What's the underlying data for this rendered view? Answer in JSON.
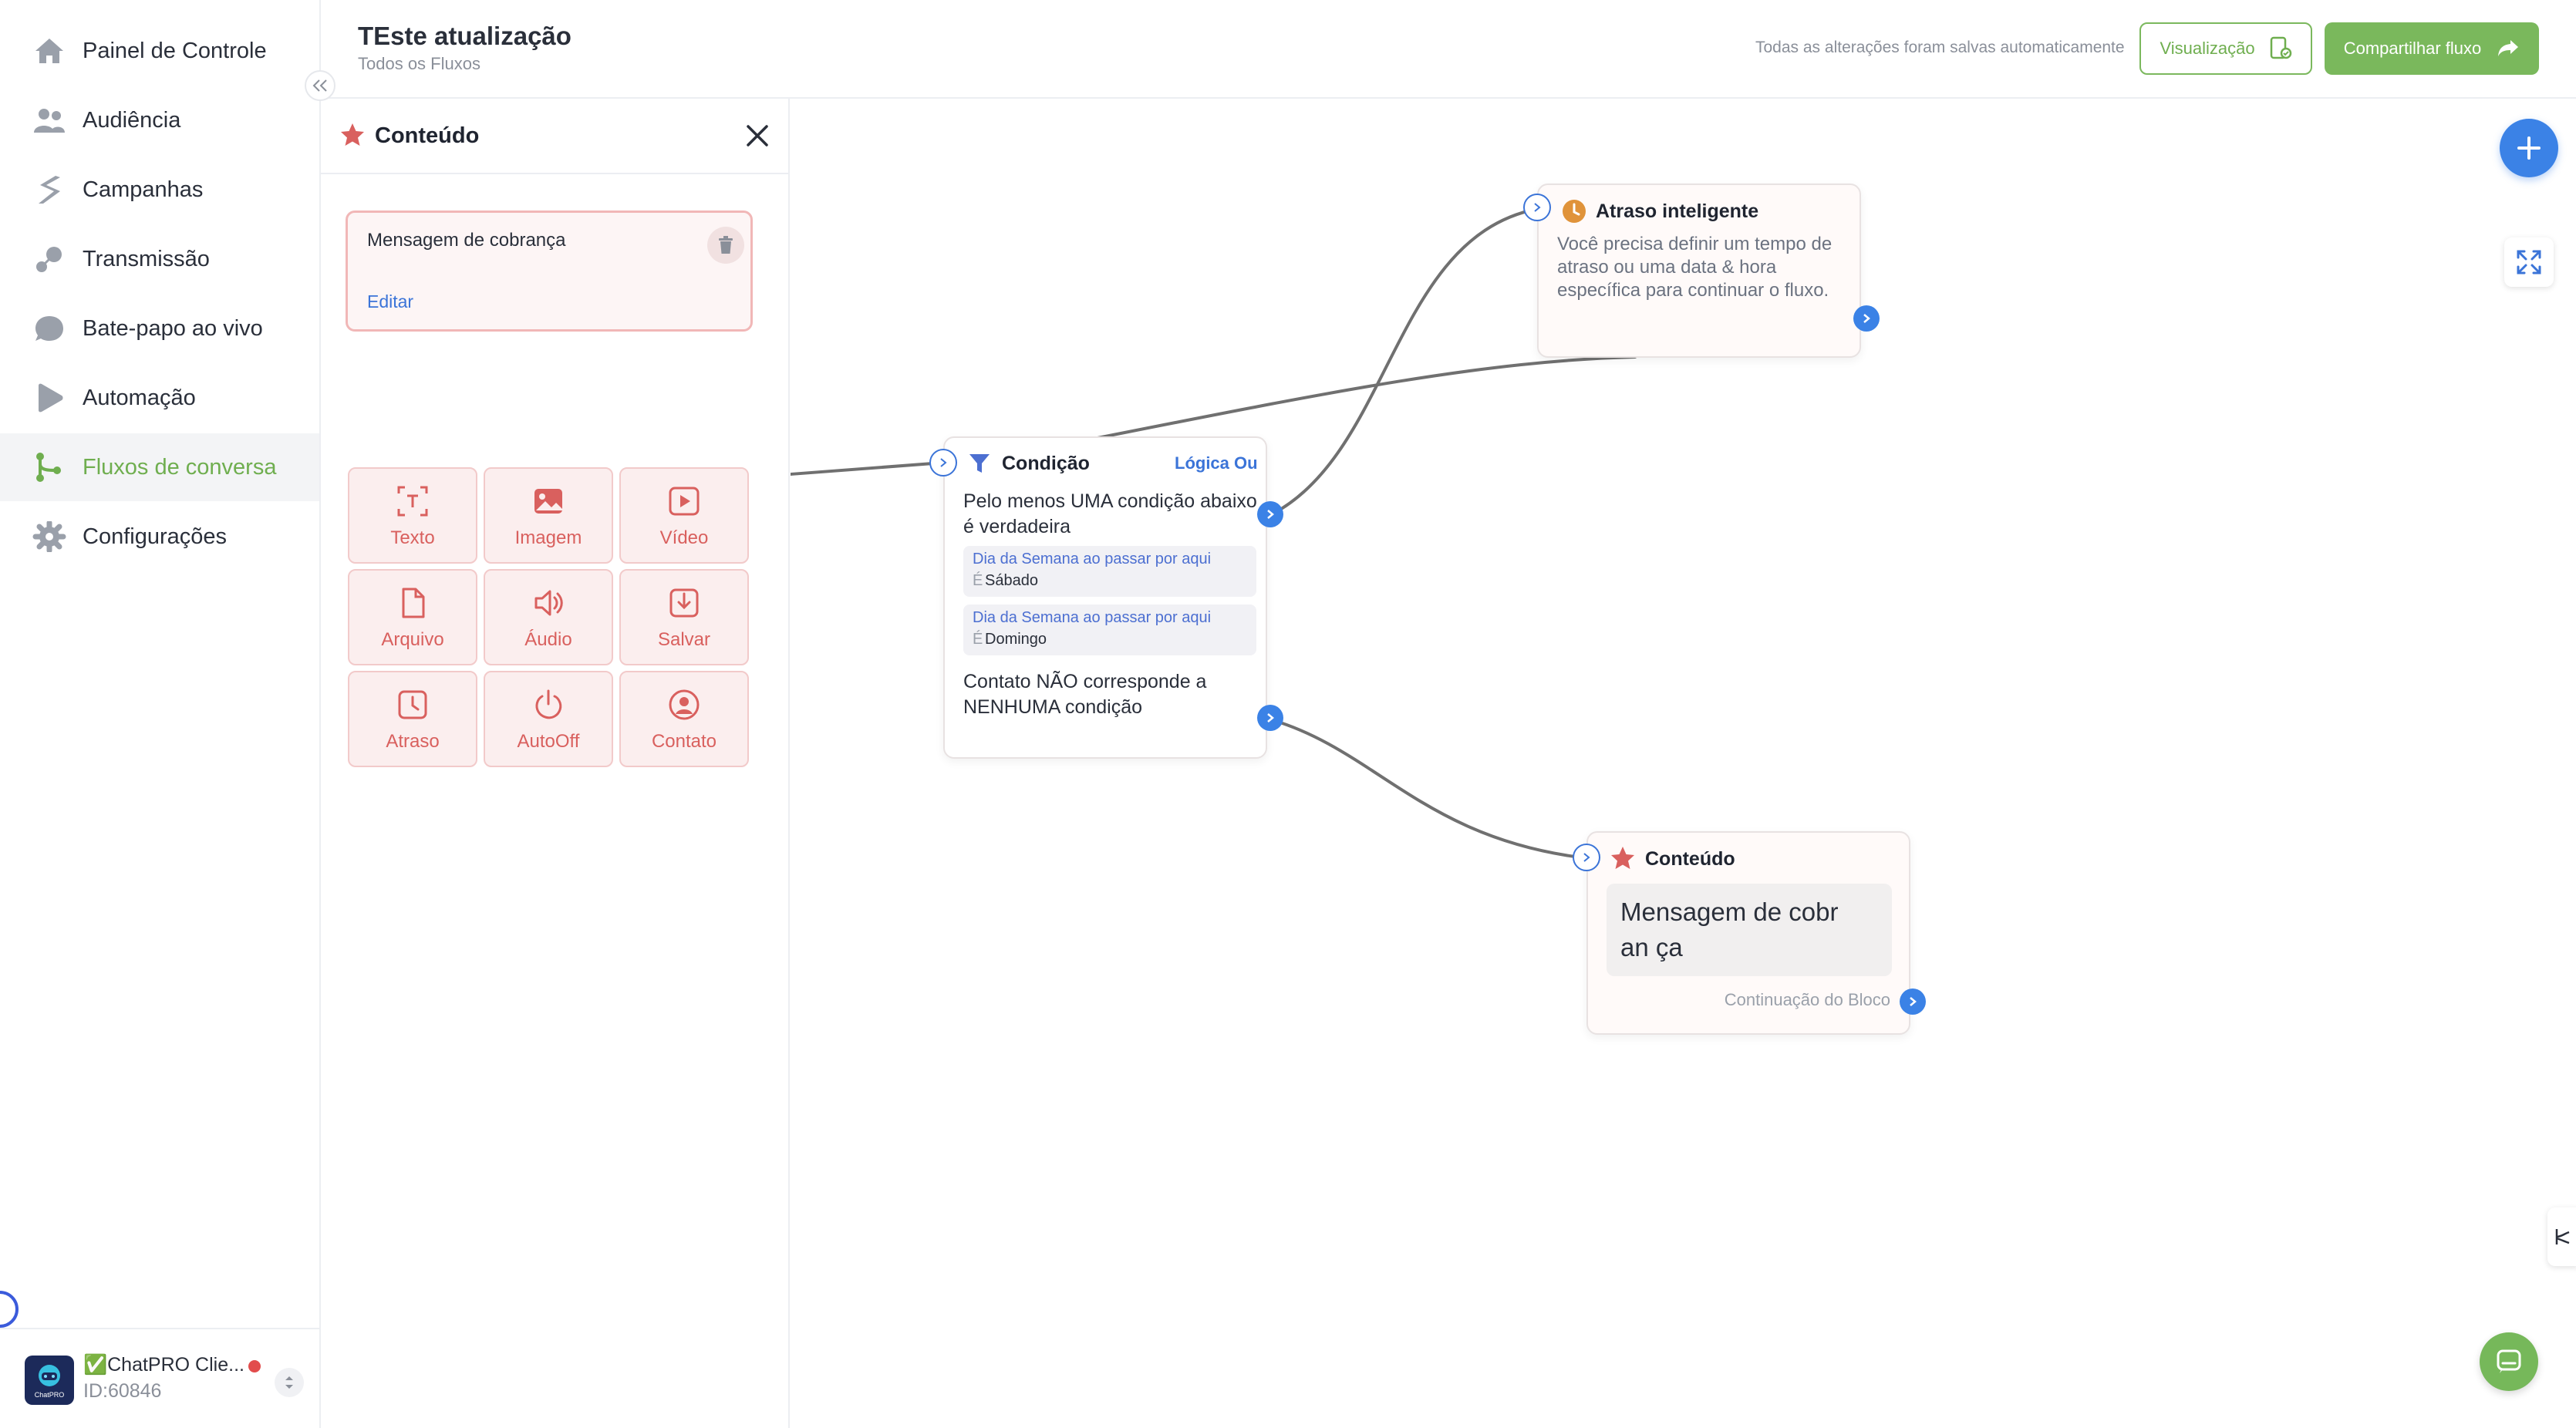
{
  "sidebar": {
    "items": [
      {
        "label": "Painel de Controle",
        "icon": "home-icon"
      },
      {
        "label": "Audiência",
        "icon": "users-icon"
      },
      {
        "label": "Campanhas",
        "icon": "campaign-icon"
      },
      {
        "label": "Transmissão",
        "icon": "broadcast-icon"
      },
      {
        "label": "Bate-papo ao vivo",
        "icon": "chat-bubble-icon"
      },
      {
        "label": "Automação",
        "icon": "play-icon"
      },
      {
        "label": "Fluxos de conversa",
        "icon": "flow-icon",
        "active": true
      },
      {
        "label": "Configurações",
        "icon": "gear-icon"
      }
    ],
    "account": {
      "name": "✅ChatPRO Clie...",
      "id": "ID:60846",
      "avatar_text": "ChatPRO"
    }
  },
  "header": {
    "title": "TEste atualização",
    "breadcrumb": "Todos os Fluxos",
    "autosave": "Todas as alterações foram salvas automaticamente",
    "preview_label": "Visualização",
    "share_label": "Compartilhar fluxo"
  },
  "panel": {
    "title": "Conteúdo",
    "message_card": {
      "title": "Mensagem de cobrança",
      "edit_label": "Editar"
    },
    "tools": [
      {
        "label": "Texto",
        "icon": "text-icon"
      },
      {
        "label": "Imagem",
        "icon": "image-icon"
      },
      {
        "label": "Vídeo",
        "icon": "video-icon"
      },
      {
        "label": "Arquivo",
        "icon": "file-icon"
      },
      {
        "label": "Áudio",
        "icon": "audio-icon"
      },
      {
        "label": "Salvar",
        "icon": "save-icon"
      },
      {
        "label": "Atraso",
        "icon": "clock-icon"
      },
      {
        "label": "AutoOff",
        "icon": "power-icon"
      },
      {
        "label": "Contato",
        "icon": "contact-icon"
      }
    ]
  },
  "canvas": {
    "delay_node": {
      "title": "Atraso inteligente",
      "text": "Você precisa definir um tempo de atraso ou uma data & hora específica para continuar o fluxo."
    },
    "condition_node": {
      "title": "Condição",
      "logic": "Lógica Ou",
      "any_true": "Pelo menos UMA condição abaixo é verdadeira",
      "conditions": [
        {
          "field": "Dia da Semana ao passar por aqui",
          "op": "É",
          "value": "Sábado"
        },
        {
          "field": "Dia da Semana ao passar por aqui",
          "op": "É",
          "value": "Domingo"
        }
      ],
      "none_match": "Contato NÃO corresponde a NENHUMA condição"
    },
    "content_node": {
      "title": "Conteúdo",
      "bubble_text": "Mensagem de cobran ça",
      "continuation": "Continuação do Bloco"
    }
  },
  "colors": {
    "brand_green": "#7ab85c",
    "accent_blue": "#3b82e6",
    "content_red": "#d9605e",
    "delay_orange": "#e0933a"
  }
}
